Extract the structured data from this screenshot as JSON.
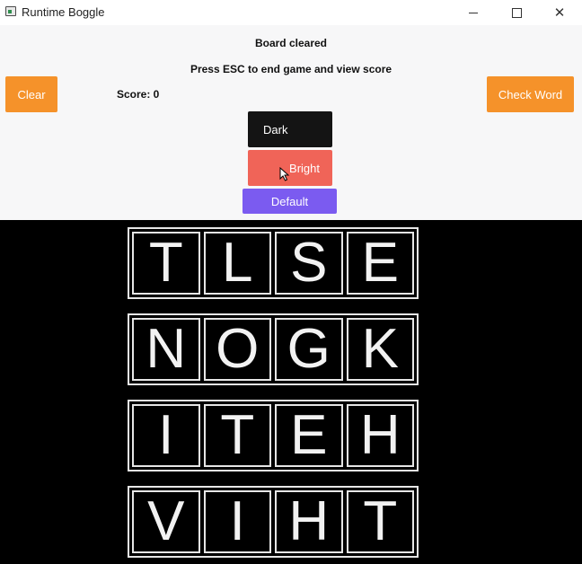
{
  "window": {
    "title": "Runtime Boggle",
    "controls": {
      "minimize": "minimize",
      "maximize": "maximize",
      "close": "✕"
    }
  },
  "status": {
    "message": "Board cleared",
    "instruction": "Press ESC to end game and view score",
    "score": "Score: 0"
  },
  "buttons": {
    "clear": "Clear",
    "check_word": "Check Word",
    "dark": "Dark",
    "bright": "Bright",
    "default": "Default"
  },
  "colors": {
    "orange": "#f5922a",
    "dark": "#141414",
    "bright": "#f06458",
    "default": "#7b5bf0",
    "board_background": "#000000"
  },
  "board": {
    "rows": [
      [
        "T",
        "L",
        "S",
        "E"
      ],
      [
        "N",
        "O",
        "G",
        "K"
      ],
      [
        "I",
        "T",
        "E",
        "H"
      ],
      [
        "V",
        "I",
        "H",
        "T"
      ]
    ]
  }
}
